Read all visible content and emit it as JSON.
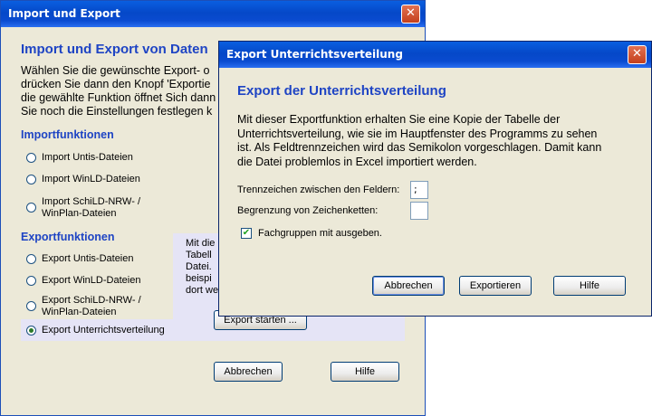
{
  "main_window": {
    "title": "Import und Export",
    "close_glyph": "✕",
    "heading": "Import und Export von Daten",
    "intro_lines": [
      "Wählen Sie die gewünschte Export- o",
      "drücken Sie dann den Knopf 'Exportie",
      "die gewählte Funktion öffnet Sich dann",
      "Sie noch die Einstellungen festlegen k"
    ],
    "import_heading": "Importfunktionen",
    "import_options": [
      {
        "lines": [
          "Import Untis-Dateien"
        ],
        "selected": false
      },
      {
        "lines": [
          "Import WinLD-Dateien"
        ],
        "selected": false
      },
      {
        "lines": [
          "Import SchiLD-NRW- /",
          "WinPlan-Dateien"
        ],
        "selected": false
      }
    ],
    "export_heading": "Exportfunktionen",
    "export_options": [
      {
        "lines": [
          "Export Untis-Dateien"
        ],
        "selected": false
      },
      {
        "lines": [
          "Export WinLD-Dateien"
        ],
        "selected": false
      },
      {
        "lines": [
          "Export SchiLD-NRW- /",
          "WinPlan-Dateien"
        ],
        "selected": false
      },
      {
        "lines": [
          "Export Unterrichtsverteilung"
        ],
        "selected": true
      }
    ],
    "panel_lines": [
      "Mit die",
      "Tabell",
      "Datei.",
      "beispi",
      "dort we"
    ],
    "start_button": "Export starten ...",
    "cancel_button": "Abbrechen",
    "help_button": "Hilfe"
  },
  "export_dialog": {
    "title": "Export Unterrichtsverteilung",
    "close_glyph": "✕",
    "heading": "Export der Unterrichtsverteilung",
    "description_lines": [
      "Mit dieser Exportfunktion erhalten Sie eine Kopie der Tabelle der",
      "Unterrichtsverteilung, wie sie im Hauptfenster des Programms zu sehen",
      "ist. Als Feldtrennzeichen wird das Semikolon vorgeschlagen. Damit kann",
      "die Datei problemlos in Excel importiert werden."
    ],
    "separator_label": "Trennzeichen zwischen den Feldern:",
    "separator_value": ";",
    "delimiter_label": "Begrenzung von Zeichenketten:",
    "delimiter_value": "",
    "checkbox_label": "Fachgruppen mit ausgeben.",
    "checkbox_checked": true,
    "checkbox_glyph": "✔",
    "cancel_button": "Abbrechen",
    "export_button": "Exportieren",
    "help_button": "Hilfe"
  }
}
